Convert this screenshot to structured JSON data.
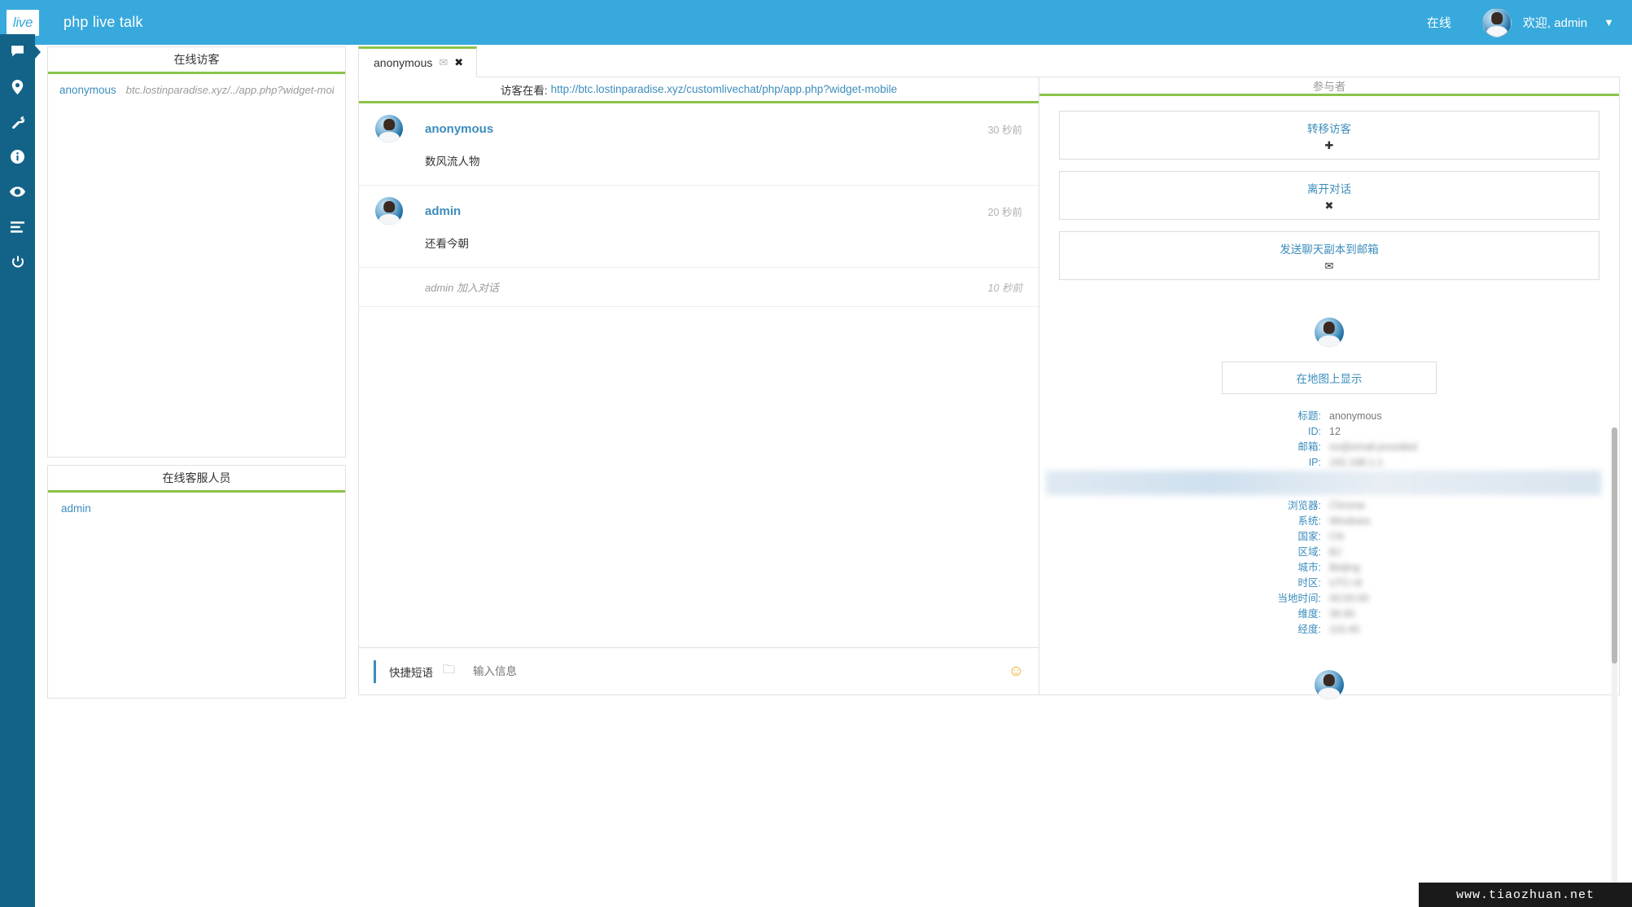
{
  "header": {
    "logo_text": "live",
    "brand": "php live talk",
    "status": "在线",
    "welcome": "欢迎, admin",
    "caret": "▼"
  },
  "rail": {
    "items": [
      {
        "name": "chat-icon",
        "label": "chat"
      },
      {
        "name": "map-pin-icon",
        "label": "map"
      },
      {
        "name": "wrench-icon",
        "label": "settings"
      },
      {
        "name": "info-icon",
        "label": "info"
      },
      {
        "name": "eye-icon",
        "label": "monitor"
      },
      {
        "name": "bars-icon",
        "label": "reports"
      },
      {
        "name": "power-icon",
        "label": "logout"
      }
    ]
  },
  "visitors_panel": {
    "title": "在线访客",
    "rows": [
      {
        "name": "anonymous",
        "url": "btc.lostinparadise.xyz/../app.php?widget-mobile"
      }
    ]
  },
  "operators_panel": {
    "title": "在线客服人员",
    "rows": [
      {
        "name": "admin"
      }
    ]
  },
  "tabs": [
    {
      "label": "anonymous",
      "mail_icon": "✉",
      "close_icon": "✖"
    }
  ],
  "viewing": {
    "label": "访客在看:",
    "url": "http://btc.lostinparadise.xyz/customlivechat/php/app.php?widget-mobile"
  },
  "messages": [
    {
      "author": "anonymous",
      "text": "数风流人物",
      "time": "30 秒前",
      "type": "message"
    },
    {
      "author": "admin",
      "text": "还看今朝",
      "time": "20 秒前",
      "type": "message"
    },
    {
      "text": "admin 加入对话",
      "time": "10 秒前",
      "type": "system"
    }
  ],
  "composer": {
    "quick_phrase": "快捷短语",
    "folder_icon": "🗀",
    "placeholder": "输入信息",
    "smiley": "☺"
  },
  "info_panel": {
    "title": "参与者",
    "actions": [
      {
        "label": "转移访客",
        "glyph": "✚",
        "name": "transfer-visitor-button"
      },
      {
        "label": "离开对话",
        "glyph": "✖",
        "name": "leave-chat-button"
      },
      {
        "label": "发送聊天副本到邮箱",
        "glyph": "✉",
        "name": "email-transcript-button"
      }
    ],
    "map_button": "在地图上显示",
    "fields": [
      {
        "key": "标题:",
        "value": "anonymous",
        "blurred": false
      },
      {
        "key": "ID:",
        "value": "12",
        "blurred": false
      },
      {
        "key": "邮箱:",
        "value": "no@email.provided",
        "blurred": true
      },
      {
        "key": "IP:",
        "value": "192.168.1.1",
        "blurred": true
      },
      {
        "key": "浏览器:",
        "value": "Chrome",
        "blurred": true
      },
      {
        "key": "系统:",
        "value": "Windows",
        "blurred": true
      },
      {
        "key": "国家:",
        "value": "CN",
        "blurred": true
      },
      {
        "key": "区域:",
        "value": "BJ",
        "blurred": true
      },
      {
        "key": "城市:",
        "value": "Beijing",
        "blurred": true
      },
      {
        "key": "时区:",
        "value": "UTC+8",
        "blurred": true
      },
      {
        "key": "当地时间:",
        "value": "00:00:00",
        "blurred": true
      },
      {
        "key": "维度:",
        "value": "39.90",
        "blurred": true
      },
      {
        "key": "经度:",
        "value": "116.40",
        "blurred": true
      }
    ]
  },
  "watermark": "www.tiaozhuan.net",
  "colors": {
    "header_blue": "#37a9dc",
    "rail_blue": "#136389",
    "accent_green": "#8bc34a",
    "link_blue": "#3c8dbc"
  }
}
